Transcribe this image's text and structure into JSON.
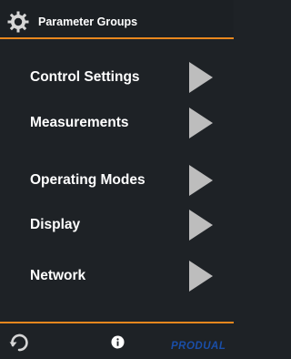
{
  "header": {
    "icon": "gear-icon",
    "title": "Parameter Groups",
    "accent_color": "#e8871e"
  },
  "menu": {
    "items": [
      {
        "label": "Control Settings",
        "icon": "chevron-right-icon"
      },
      {
        "label": "Measurements",
        "icon": "chevron-right-icon"
      },
      {
        "label": "Operating Modes",
        "icon": "chevron-right-icon"
      },
      {
        "label": "Display",
        "icon": "chevron-right-icon"
      },
      {
        "label": "Network",
        "icon": "chevron-right-icon"
      }
    ]
  },
  "footer": {
    "back_icon": "back-icon",
    "info_icon": "info-icon",
    "brand_text": "PRODUAL",
    "brand_color": "#1a4ea8"
  },
  "colors": {
    "background": "#1e2226",
    "text": "#ffffff",
    "arrow": "#bdbdbd"
  }
}
